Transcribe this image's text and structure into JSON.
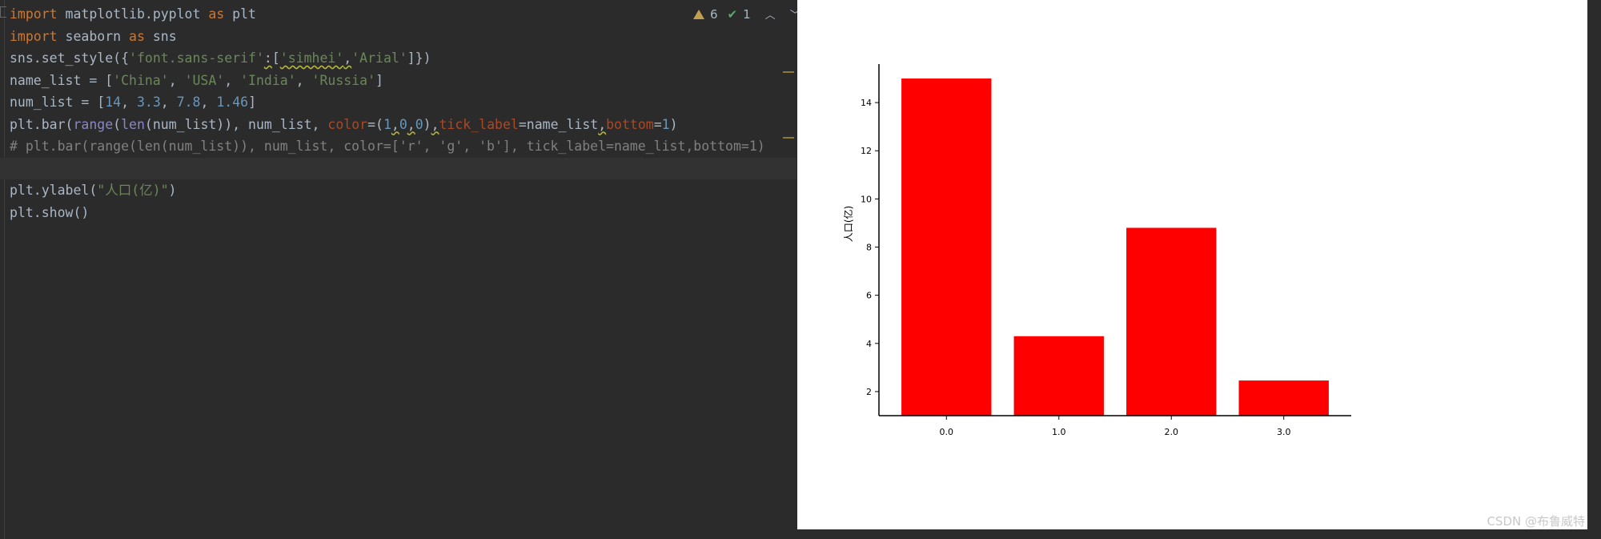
{
  "editor": {
    "lines": [
      {
        "parts": [
          {
            "t": "import",
            "c": "kw"
          },
          {
            "t": " matplotlib.pyplot ",
            "c": ""
          },
          {
            "t": "as",
            "c": "kw"
          },
          {
            "t": " plt",
            "c": ""
          }
        ]
      },
      {
        "parts": [
          {
            "t": "import",
            "c": "kw"
          },
          {
            "t": " seaborn ",
            "c": ""
          },
          {
            "t": "as",
            "c": "kw"
          },
          {
            "t": " sns",
            "c": ""
          }
        ]
      },
      {
        "parts": [
          {
            "t": "sns.set_style({",
            "c": ""
          },
          {
            "t": "'font.sans-serif'",
            "c": "str"
          },
          {
            "t": ":",
            "c": "wavy"
          },
          {
            "t": "[",
            "c": ""
          },
          {
            "t": "'simhei'",
            "c": "str wavy"
          },
          {
            "t": ",",
            "c": "wavy"
          },
          {
            "t": "'Arial'",
            "c": "str"
          },
          {
            "t": "]})",
            "c": ""
          }
        ]
      },
      {
        "parts": [
          {
            "t": "name_list = [",
            "c": ""
          },
          {
            "t": "'China'",
            "c": "str"
          },
          {
            "t": ", ",
            "c": ""
          },
          {
            "t": "'USA'",
            "c": "str"
          },
          {
            "t": ", ",
            "c": ""
          },
          {
            "t": "'India'",
            "c": "str"
          },
          {
            "t": ", ",
            "c": ""
          },
          {
            "t": "'Russia'",
            "c": "str"
          },
          {
            "t": "]",
            "c": ""
          }
        ]
      },
      {
        "parts": [
          {
            "t": "num_list = [",
            "c": ""
          },
          {
            "t": "14",
            "c": "num"
          },
          {
            "t": ", ",
            "c": ""
          },
          {
            "t": "3.3",
            "c": "num"
          },
          {
            "t": ", ",
            "c": ""
          },
          {
            "t": "7.8",
            "c": "num"
          },
          {
            "t": ", ",
            "c": ""
          },
          {
            "t": "1.46",
            "c": "num"
          },
          {
            "t": "]",
            "c": ""
          }
        ]
      },
      {
        "parts": [
          {
            "t": "plt.bar(",
            "c": ""
          },
          {
            "t": "range",
            "c": "fn"
          },
          {
            "t": "(",
            "c": ""
          },
          {
            "t": "len",
            "c": "fn"
          },
          {
            "t": "(num_list)), num_list, ",
            "c": ""
          },
          {
            "t": "color",
            "c": "param"
          },
          {
            "t": "=(",
            "c": ""
          },
          {
            "t": "1",
            "c": "num"
          },
          {
            "t": ",",
            "c": "wavy"
          },
          {
            "t": "0",
            "c": "num"
          },
          {
            "t": ",",
            "c": "wavy"
          },
          {
            "t": "0",
            "c": "num"
          },
          {
            "t": ")",
            "c": ""
          },
          {
            "t": ",",
            "c": "wavy"
          },
          {
            "t": "tick_label",
            "c": "param"
          },
          {
            "t": "=name_list",
            "c": ""
          },
          {
            "t": ",",
            "c": "wavy"
          },
          {
            "t": "bottom",
            "c": "param"
          },
          {
            "t": "=",
            "c": ""
          },
          {
            "t": "1",
            "c": "num"
          },
          {
            "t": ")",
            "c": ""
          }
        ]
      },
      {
        "parts": [
          {
            "t": "# plt.bar(range(len(num_list)), num_list, color=['r', 'g', 'b'], tick_label=name_list,bottom=1)",
            "c": "cmt"
          }
        ]
      },
      {
        "parts": [
          {
            "t": "",
            "c": ""
          }
        ],
        "current": true
      },
      {
        "parts": [
          {
            "t": "plt.ylabel(",
            "c": ""
          },
          {
            "t": "\"人口(亿)\"",
            "c": "str"
          },
          {
            "t": ")",
            "c": ""
          }
        ]
      },
      {
        "parts": [
          {
            "t": "plt.show()",
            "c": ""
          }
        ]
      }
    ]
  },
  "inspections": {
    "warnings": "6",
    "weak_warnings": "1"
  },
  "chart_data": {
    "type": "bar",
    "categories": [
      "0.0",
      "1.0",
      "2.0",
      "3.0"
    ],
    "values": [
      14,
      3.3,
      7.8,
      1.46
    ],
    "bottom": 1,
    "color": "#ff0000",
    "title": "",
    "xlabel": "",
    "ylabel": "人口(亿)",
    "ylim": [
      1,
      15.6
    ],
    "yticks": [
      2,
      4,
      6,
      8,
      10,
      12,
      14
    ],
    "grid": false
  },
  "watermark": "CSDN @布鲁威特"
}
